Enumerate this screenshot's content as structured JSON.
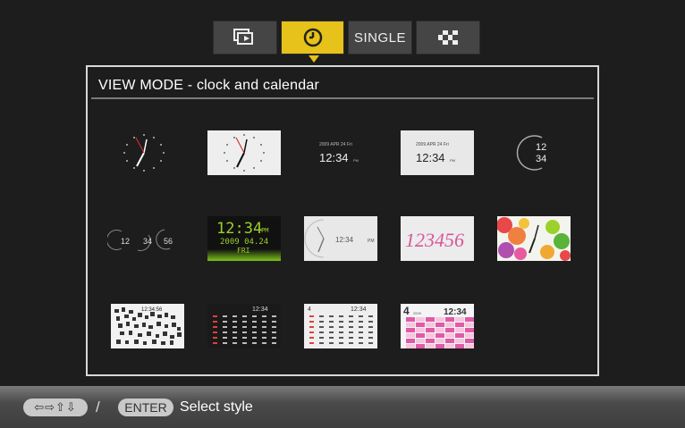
{
  "tabs": [
    {
      "id": "slideshow",
      "icon": "slideshow-icon",
      "label": ""
    },
    {
      "id": "clock",
      "icon": "clock-icon",
      "label": "",
      "active": true
    },
    {
      "id": "single",
      "label": "SINGLE"
    },
    {
      "id": "index",
      "icon": "index-grid-icon",
      "label": ""
    }
  ],
  "panel": {
    "title": "VIEW MODE - clock and calendar"
  },
  "thumbs": {
    "t3_date": "2009 APR 24 Fri",
    "t3_time": "12:34",
    "t3_ampm": "PM",
    "t4_date": "2009 APR 24 Fri",
    "t4_time": "12:34",
    "t4_ampm": "PM",
    "t5_hour": "12",
    "t5_min": "34",
    "t6_h": "12",
    "t6_m": "34",
    "t6_s": "56",
    "t7_time": "12:34",
    "t7_pm": "PM",
    "t7_date": "2009 04.24",
    "t7_day": "FRI",
    "t8_time": "12:34",
    "t8_pm": "PM",
    "t9_digits": "123456",
    "t11_time": "12:34:56",
    "t12_time": "12:34",
    "t13_month": "4",
    "t13_time": "12:34",
    "t14_month": "4",
    "t14_year": "2009",
    "t14_time": "12:34"
  },
  "footer": {
    "arrows": "⇦⇨⇧⇩",
    "slash": "/",
    "enter": "ENTER",
    "hint": "Select style"
  },
  "colors": {
    "accent": "#e6c21a",
    "background": "#1d1d1d",
    "green": "#9bd12a",
    "pink": "#e05aa8"
  }
}
